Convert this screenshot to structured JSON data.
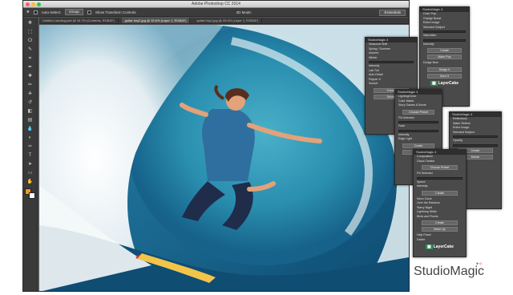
{
  "app": {
    "title": "Adobe Photoshop CC 2014",
    "window_dots": [
      "#ff5f57",
      "#febc2e",
      "#28c840"
    ]
  },
  "options_bar": {
    "auto_select_label": "Auto-Select:",
    "auto_select_value": "Group",
    "transform_controls_label": "Show Transform Controls",
    "mode_3d_label": "3D Mode:",
    "workspace": "Essentials"
  },
  "doc_tabs": [
    "Untitled Landing.psd @ 16.7% (Contents, RGB/8*)",
    "guitar boy2.jpg @ 33.6% (Layer 1, RGB/8*)",
    "guitar boy1.jpg @ 33.6% (Layer 1, RGB/8*)"
  ],
  "tools": [
    "move-icon",
    "marquee-icon",
    "lasso-icon",
    "quick-select-icon",
    "crop-icon",
    "eyedropper-icon",
    "healing-icon",
    "brush-icon",
    "stamp-icon",
    "history-brush-icon",
    "eraser-icon",
    "gradient-icon",
    "blur-icon",
    "dodge-icon",
    "pen-icon",
    "type-icon",
    "path-select-icon",
    "shape-icon",
    "hand-icon",
    "zoom-icon"
  ],
  "tool_glyphs": [
    "✥",
    "⬚",
    "ⵔ",
    "✎",
    "⌗",
    "✒",
    "✚",
    "✏",
    "⎈",
    "↺",
    "◧",
    "▤",
    "💧",
    "◐",
    "✑",
    "T",
    "➤",
    "▭",
    "✋",
    "⌕"
  ],
  "colors": {
    "foreground": "#f39a1e",
    "background": "#ffffff"
  },
  "panels": {
    "p1": {
      "title": "StudioMagic 4",
      "rows": [
        "Color Pop",
        "Orange Boost",
        "Entire Image",
        "Selected Subject",
        "Saturation",
        "Intensity",
        "Create",
        "Make Pop",
        "Dodge Burn",
        "Dodge It",
        "Burn It"
      ],
      "logo": "LayerCake"
    },
    "p2": {
      "title": "StudioMagic 4",
      "rows": [
        "Seasonal Shift",
        "Spring / Summer",
        "Autumn",
        "Winter",
        "Intensity",
        "Lab Tint",
        "Auto Detail",
        "Pepper It",
        "Sunset",
        "Create",
        "Delete"
      ]
    },
    "p3": {
      "title": "StudioMagic 4",
      "rows": [
        "Lighting/Color",
        "Color Match",
        "Story Gaines & Borde",
        "Choose Preset",
        "Fill Selected",
        "Fade",
        "Intensity",
        "Edge Light",
        "Create",
        "Delete"
      ]
    },
    "p4": {
      "title": "StudioMagic 4",
      "rows": [
        "Reflections",
        "Water Reflect",
        "Entire Image",
        "Selected Subject",
        "Opacity",
        "Create",
        "Delete"
      ]
    },
    "p5": {
      "title": "StudioMagic 4",
      "rows": [
        "Composition",
        "Cloud Creator",
        "Choose Preset",
        "Fill Selected",
        "Speed",
        "Intensity",
        "Create",
        "Neon Clock",
        "Over the Rainbow",
        "Starry Night",
        "Lightning Strike",
        "Birds and Flocks",
        "Create",
        "Make Up",
        "Help Panel",
        "Delete"
      ],
      "logo": "LayerCake"
    }
  },
  "brand": "StudioMagic"
}
